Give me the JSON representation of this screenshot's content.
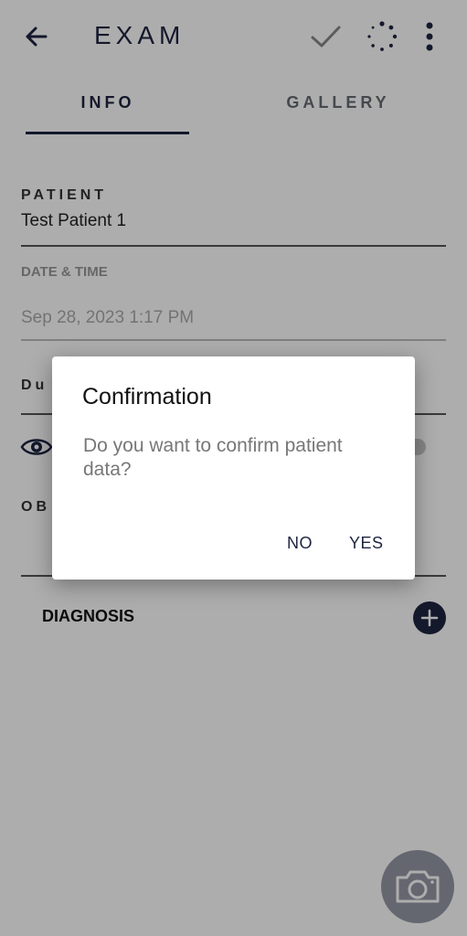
{
  "header": {
    "title": "EXAM",
    "icons": [
      "arrow-back-icon",
      "check-icon",
      "loading-spinner-icon",
      "more-vert-icon"
    ]
  },
  "tabs": [
    {
      "label": "INFO",
      "selected": true
    },
    {
      "label": "GALLERY",
      "selected": false
    }
  ],
  "form": {
    "patient_label": "PATIENT",
    "patient_value": "Test Patient 1",
    "datetime_label": "DATE & TIME",
    "datetime_value": "Sep 28, 2023 1:17 PM",
    "duration_label_partial": "Du",
    "observations_label_partial": "OB",
    "diagnosis_label": "DIAGNOSIS"
  },
  "dialog": {
    "title": "Confirmation",
    "message": "Do you want to confirm patient data?",
    "no_label": "NO",
    "yes_label": "YES"
  },
  "colors": {
    "accent": "#1c2440",
    "scrim": "rgba(0,0,0,0.32)",
    "fab": "#9598a6"
  }
}
